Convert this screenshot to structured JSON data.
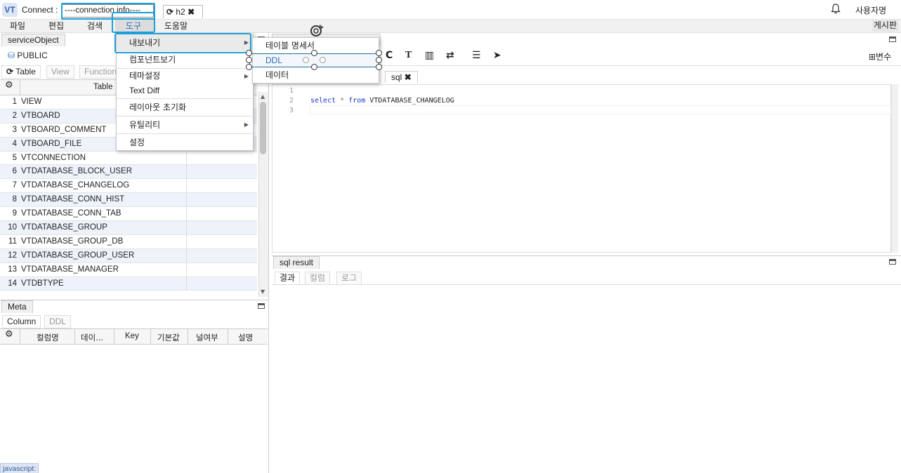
{
  "topbar": {
    "logo": "VT",
    "connect_label": "Connect :",
    "connection_select": "----connection info----",
    "conn_tab_label": "h2",
    "user": "사용자명"
  },
  "menubar": {
    "items": [
      "파일",
      "편집",
      "검색",
      "도구",
      "도움말"
    ],
    "board": "게시판"
  },
  "tools_menu": {
    "items": [
      "내보내기",
      "컴포넌트보기",
      "테마설정",
      "Text Diff",
      "레이아웃 초기화",
      "유틸리티",
      "설정"
    ]
  },
  "export_submenu": {
    "items": [
      "테이블 명세서",
      "DDL",
      "데이터"
    ]
  },
  "object_panel": {
    "tab": "serviceObject",
    "schema": "PUBLIC",
    "subtabs": [
      "Table",
      "View",
      "Function"
    ],
    "column_header": "Table",
    "rows": [
      {
        "num": "1",
        "name": "VIEW"
      },
      {
        "num": "2",
        "name": "VTBOARD"
      },
      {
        "num": "3",
        "name": "VTBOARD_COMMENT"
      },
      {
        "num": "4",
        "name": "VTBOARD_FILE"
      },
      {
        "num": "5",
        "name": "VTCONNECTION"
      },
      {
        "num": "6",
        "name": "VTDATABASE_BLOCK_USER"
      },
      {
        "num": "7",
        "name": "VTDATABASE_CHANGELOG"
      },
      {
        "num": "8",
        "name": "VTDATABASE_CONN_HIST"
      },
      {
        "num": "9",
        "name": "VTDATABASE_CONN_TAB"
      },
      {
        "num": "10",
        "name": "VTDATABASE_GROUP"
      },
      {
        "num": "11",
        "name": "VTDATABASE_GROUP_DB"
      },
      {
        "num": "12",
        "name": "VTDATABASE_GROUP_USER"
      },
      {
        "num": "13",
        "name": "VTDATABASE_MANAGER"
      },
      {
        "num": "14",
        "name": "VTDBTYPE"
      }
    ]
  },
  "meta_panel": {
    "tab": "Meta",
    "subtabs": [
      "Column",
      "DDL"
    ],
    "columns": [
      "컬럼명",
      "데이...",
      "Key",
      "기본값",
      "널여부",
      "설명"
    ]
  },
  "editor": {
    "tab": "sql",
    "variables_button": "⊞변수",
    "lines": [
      "1",
      "2",
      "3"
    ],
    "code": {
      "kw1": "select",
      "star": "*",
      "kw2": "from",
      "table": "VTDATABASE_CHANGELOG"
    }
  },
  "result_panel": {
    "tab": "sql result",
    "subtabs": [
      "결과",
      "컬럼",
      "로그"
    ]
  },
  "status": {
    "bottom_label": "javascript:"
  }
}
